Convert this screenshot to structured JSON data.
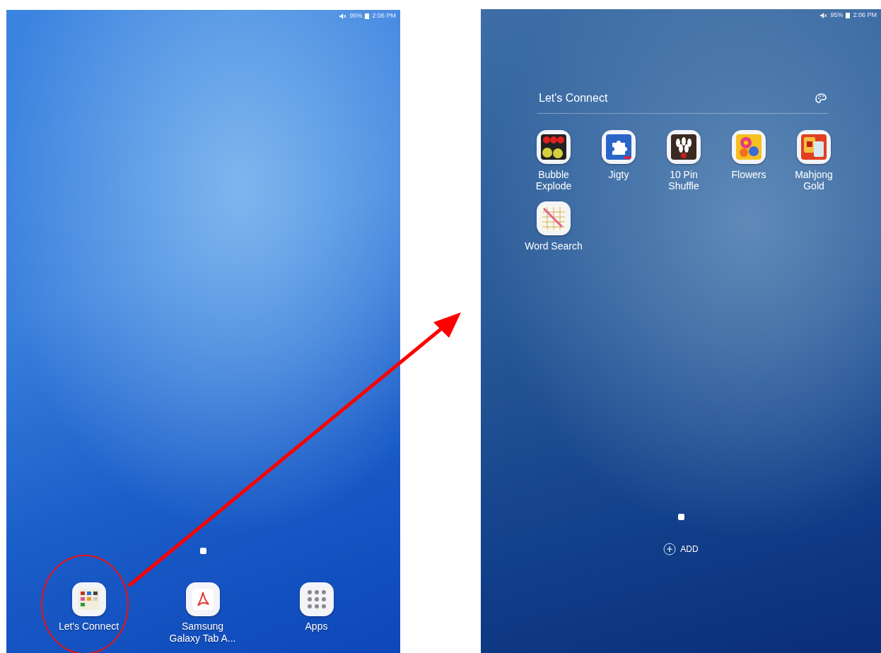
{
  "screens": [
    {
      "kind": "home",
      "status_bar": {
        "battery": "95%",
        "time": "2:06 PM"
      },
      "dock": [
        {
          "label": "Let's Connect",
          "kind": "folder",
          "circled": true
        },
        {
          "label": "Samsung\nGalaxy Tab A...",
          "kind": "pdf",
          "circled": false
        },
        {
          "label": "Apps",
          "kind": "apps",
          "circled": false
        }
      ]
    },
    {
      "kind": "folder",
      "status_bar": {
        "battery": "95%",
        "time": "2:06 PM"
      },
      "folder": {
        "title": "Let's Connect",
        "apps": [
          {
            "label": "Bubble\nExplode",
            "kind": "bubbles"
          },
          {
            "label": "Jigty",
            "kind": "puzzle"
          },
          {
            "label": "10 Pin\nShuffle",
            "kind": "bowling"
          },
          {
            "label": "Flowers",
            "kind": "flowers"
          },
          {
            "label": "Mahjong\nGold",
            "kind": "mahjong"
          },
          {
            "label": "Word Search",
            "kind": "wordsearch"
          }
        ],
        "add_label": "ADD"
      }
    }
  ]
}
